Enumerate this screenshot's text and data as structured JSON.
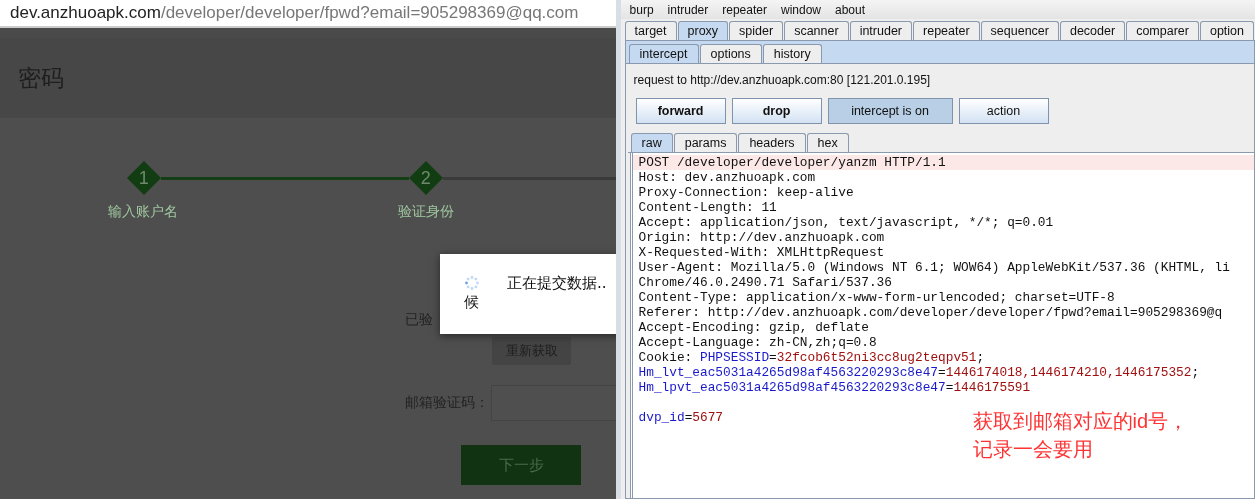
{
  "browser": {
    "url_host": "dev.anzhuoapk.com",
    "url_path": "/developer/developer/fpwd?email=905298369@qq.com"
  },
  "page": {
    "title": "密码",
    "steps": [
      {
        "number": "1",
        "label": "输入账户名",
        "completed": true
      },
      {
        "number": "2",
        "label": "验证身份",
        "completed": false
      }
    ],
    "verified_label": "已验",
    "resend_button": "重新获取",
    "code_label": "邮箱验证码：",
    "next_button": "下一步"
  },
  "dialog": {
    "message": "正在提交数据..",
    "message_cont": "候"
  },
  "burp": {
    "menu": [
      "burp",
      "intruder",
      "repeater",
      "window",
      "about"
    ],
    "tabs": [
      {
        "label": "target",
        "selected": false
      },
      {
        "label": "proxy",
        "selected": true
      },
      {
        "label": "spider",
        "selected": false
      },
      {
        "label": "scanner",
        "selected": false
      },
      {
        "label": "intruder",
        "selected": false
      },
      {
        "label": "repeater",
        "selected": false
      },
      {
        "label": "sequencer",
        "selected": false
      },
      {
        "label": "decoder",
        "selected": false
      },
      {
        "label": "comparer",
        "selected": false
      },
      {
        "label": "option",
        "selected": false
      }
    ],
    "subtabs": [
      {
        "label": "intercept",
        "selected": true
      },
      {
        "label": "options",
        "selected": false
      },
      {
        "label": "history",
        "selected": false
      }
    ],
    "request_info": "request to http://dev.anzhuoapk.com:80  [121.201.0.195]",
    "buttons": [
      {
        "label": "forward",
        "bold": true,
        "pressed": false
      },
      {
        "label": "drop",
        "bold": true,
        "pressed": false
      },
      {
        "label": "intercept is on",
        "bold": false,
        "pressed": true
      },
      {
        "label": "action",
        "bold": false,
        "pressed": false
      }
    ],
    "view_tabs": [
      {
        "label": "raw",
        "selected": true
      },
      {
        "label": "params",
        "selected": false
      },
      {
        "label": "headers",
        "selected": false
      },
      {
        "label": "hex",
        "selected": false
      }
    ],
    "lines": [
      {
        "highlighted": true,
        "segments": [
          {
            "kind": "text",
            "text": "POST /developer/developer/yanzm HTTP/1.1"
          }
        ]
      },
      {
        "highlighted": false,
        "segments": [
          {
            "kind": "text",
            "text": "Host: dev.anzhuoapk.com"
          }
        ]
      },
      {
        "highlighted": false,
        "segments": [
          {
            "kind": "text",
            "text": "Proxy-Connection: keep-alive"
          }
        ]
      },
      {
        "highlighted": false,
        "segments": [
          {
            "kind": "text",
            "text": "Content-Length: 11"
          }
        ]
      },
      {
        "highlighted": false,
        "segments": [
          {
            "kind": "text",
            "text": "Accept: application/json, text/javascript, */*; q=0.01"
          }
        ]
      },
      {
        "highlighted": false,
        "segments": [
          {
            "kind": "text",
            "text": "Origin: http://dev.anzhuoapk.com"
          }
        ]
      },
      {
        "highlighted": false,
        "segments": [
          {
            "kind": "text",
            "text": "X-Requested-With: XMLHttpRequest"
          }
        ]
      },
      {
        "highlighted": false,
        "segments": [
          {
            "kind": "text",
            "text": "User-Agent: Mozilla/5.0 (Windows NT 6.1; WOW64) AppleWebKit/537.36 (KHTML, li"
          }
        ]
      },
      {
        "highlighted": false,
        "segments": [
          {
            "kind": "text",
            "text": "Chrome/46.0.2490.71 Safari/537.36"
          }
        ]
      },
      {
        "highlighted": false,
        "segments": [
          {
            "kind": "text",
            "text": "Content-Type: application/x-www-form-urlencoded; charset=UTF-8"
          }
        ]
      },
      {
        "highlighted": false,
        "segments": [
          {
            "kind": "text",
            "text": "Referer: http://dev.anzhuoapk.com/developer/developer/fpwd?email=905298369@q"
          }
        ]
      },
      {
        "highlighted": false,
        "segments": [
          {
            "kind": "text",
            "text": "Accept-Encoding: gzip, deflate"
          }
        ]
      },
      {
        "highlighted": false,
        "segments": [
          {
            "kind": "text",
            "text": "Accept-Language: zh-CN,zh;q=0.8"
          }
        ]
      },
      {
        "highlighted": false,
        "segments": [
          {
            "kind": "text",
            "text": "Cookie: "
          },
          {
            "kind": "name",
            "text": "PHPSESSID"
          },
          {
            "kind": "text",
            "text": "="
          },
          {
            "kind": "value",
            "text": "32fcob6t52ni3cc8ug2teqpv51"
          },
          {
            "kind": "text",
            "text": ";"
          }
        ]
      },
      {
        "highlighted": false,
        "segments": [
          {
            "kind": "name",
            "text": "Hm_lvt_eac5031a4265d98af4563220293c8e47"
          },
          {
            "kind": "text",
            "text": "="
          },
          {
            "kind": "value",
            "text": "1446174018,1446174210,1446175352"
          },
          {
            "kind": "text",
            "text": ";"
          }
        ]
      },
      {
        "highlighted": false,
        "segments": [
          {
            "kind": "name",
            "text": "Hm_lpvt_eac5031a4265d98af4563220293c8e47"
          },
          {
            "kind": "text",
            "text": "="
          },
          {
            "kind": "value",
            "text": "1446175591"
          }
        ]
      },
      {
        "highlighted": false
      },
      {
        "highlighted": false,
        "segments": [
          {
            "kind": "name",
            "text": "dvp_id"
          },
          {
            "kind": "text",
            "text": "="
          },
          {
            "kind": "value",
            "text": "5677"
          }
        ]
      }
    ]
  },
  "annotation": {
    "lines": [
      "获取到邮箱对应的id号，",
      "记录一会要用"
    ]
  }
}
